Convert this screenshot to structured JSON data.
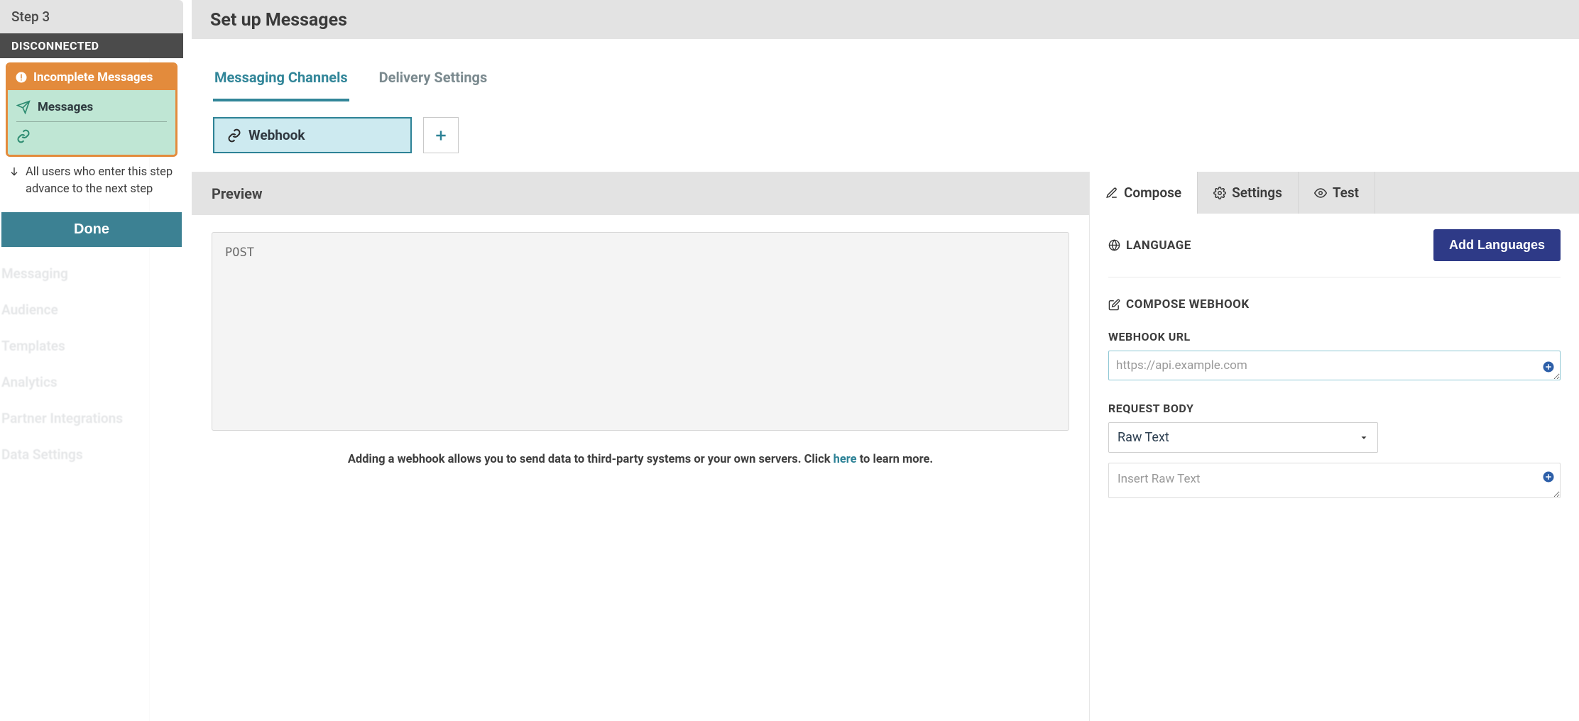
{
  "step_panel": {
    "step_label": "Step 3",
    "status": "DISCONNECTED",
    "card_head": "Incomplete Messages",
    "messages_label": "Messages",
    "note_text": "All users who enter this step advance to the next step",
    "done_label": "Done"
  },
  "bg_nav": {
    "items": [
      "Messaging",
      "Audience",
      "Templates",
      "Analytics",
      "Partner Integrations",
      "Data Settings"
    ]
  },
  "main": {
    "title": "Set up Messages",
    "tabs": [
      {
        "label": "Messaging Channels",
        "active": true
      },
      {
        "label": "Delivery Settings",
        "active": false
      }
    ],
    "channel_label": "Webhook"
  },
  "preview": {
    "header": "Preview",
    "method": "POST",
    "caption_pre": "Adding a webhook allows you to send data to third-party systems or your own servers. Click ",
    "caption_link": "here",
    "caption_post": " to learn more."
  },
  "editor": {
    "tabs": [
      {
        "label": "Compose",
        "icon": "pencil",
        "active": true
      },
      {
        "label": "Settings",
        "icon": "gear",
        "active": false
      },
      {
        "label": "Test",
        "icon": "eye",
        "active": false
      }
    ],
    "language_label": "LANGUAGE",
    "add_languages_label": "Add Languages",
    "section_compose": "COMPOSE WEBHOOK",
    "url_label": "WEBHOOK URL",
    "url_placeholder": "https://api.example.com",
    "body_label": "REQUEST BODY",
    "body_select_value": "Raw Text",
    "raw_placeholder": "Insert Raw Text"
  }
}
